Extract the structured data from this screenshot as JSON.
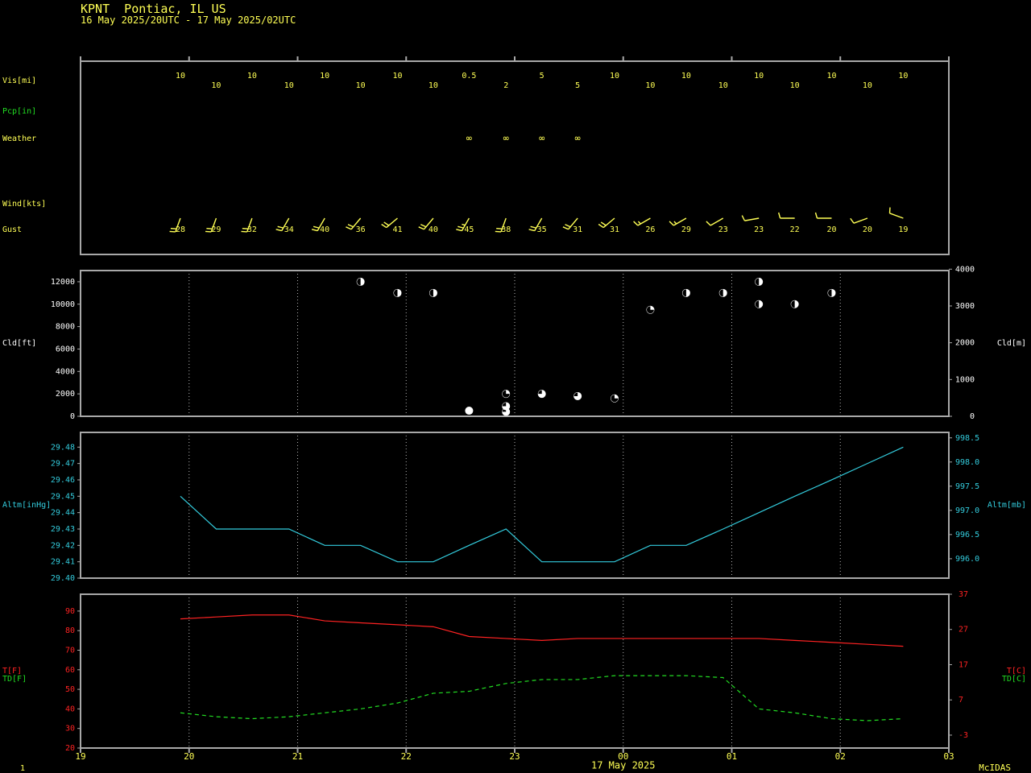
{
  "header": {
    "station": "KPNT  Pontiac, IL US",
    "period": "16 May 2025/20UTC - 17 May 2025/02UTC"
  },
  "footer": {
    "page": "1",
    "center_date": "17 May 2025",
    "credit": "McIDAS"
  },
  "labels": {
    "vis": "Vis[mi]",
    "pcp": "Pcp[in]",
    "weather": "Weather",
    "wind": "Wind[kts]",
    "gust": "Gust",
    "cld_ft": "Cld[ft]",
    "cld_m": "Cld[m]",
    "altm_inhg": "Altm[inHg]",
    "altm_mb": "Altm[mb]",
    "t_f": "T[F]",
    "td_f": "TD[F]",
    "t_c": "T[C]",
    "td_c": "TD[C]"
  },
  "colors": {
    "background": "#000000",
    "frame": "#a8a8a8",
    "grid": "#b4b4b4",
    "yellow": "#ffff55",
    "green": "#22dd22",
    "cyan": "#33ccdd",
    "red": "#ff2222",
    "white": "#ffffff"
  },
  "chart_data": {
    "type": "line",
    "x_axis": {
      "unit": "UTC hour",
      "ticks": [
        "19",
        "20",
        "21",
        "22",
        "23",
        "00",
        "01",
        "02",
        "03"
      ],
      "range": [
        19,
        27
      ]
    },
    "observation_times": [
      19.92,
      20.25,
      20.58,
      20.92,
      21.25,
      21.58,
      21.92,
      22.25,
      22.58,
      22.92,
      23.25,
      23.58,
      23.92,
      24.25,
      24.58,
      24.92,
      25.25,
      25.58,
      25.92,
      26.25,
      26.58
    ],
    "visibility": {
      "unit": "mi",
      "values": [
        "10",
        "10",
        "10",
        "10",
        "10",
        "10",
        "10",
        "10",
        "0.5",
        "2",
        "5",
        "5",
        "10",
        "10",
        "10",
        "10",
        "10",
        "10",
        "10",
        "10",
        "10"
      ]
    },
    "weather": {
      "symbol": "∞",
      "times": [
        22.58,
        22.92,
        23.25,
        23.58
      ]
    },
    "wind": {
      "unit": "kts",
      "directions_deg": [
        200,
        200,
        200,
        210,
        210,
        220,
        230,
        220,
        210,
        200,
        210,
        220,
        230,
        240,
        240,
        240,
        260,
        270,
        270,
        250,
        290
      ],
      "speeds_kts": [
        20,
        20,
        20,
        20,
        20,
        20,
        20,
        20,
        25,
        20,
        20,
        20,
        20,
        15,
        15,
        10,
        10,
        10,
        10,
        10,
        10
      ],
      "gusts": [
        "28",
        "29",
        "32",
        "34",
        "40",
        "36",
        "41",
        "40",
        "45",
        "38",
        "35",
        "31",
        "31",
        "26",
        "29",
        "23",
        "23",
        "22",
        "20",
        "20",
        "19"
      ]
    },
    "cloud": {
      "unit_left": "ft",
      "unit_right": "m",
      "y_ticks_ft": [
        "0",
        "2000",
        "4000",
        "6000",
        "8000",
        "10000",
        "12000"
      ],
      "y_ticks_m": [
        "0",
        "1000",
        "2000",
        "3000",
        "4000"
      ],
      "ylim_ft": [
        0,
        13000
      ],
      "layers": [
        {
          "t": 21.58,
          "ft": 12000,
          "cover": "half"
        },
        {
          "t": 21.92,
          "ft": 11000,
          "cover": "half"
        },
        {
          "t": 22.25,
          "ft": 11000,
          "cover": "half"
        },
        {
          "t": 22.58,
          "ft": 500,
          "cover": "overcast"
        },
        {
          "t": 22.92,
          "ft": 400,
          "cover": "three-quarter"
        },
        {
          "t": 22.92,
          "ft": 900,
          "cover": "three-quarter"
        },
        {
          "t": 22.92,
          "ft": 2000,
          "cover": "quarter"
        },
        {
          "t": 23.25,
          "ft": 2000,
          "cover": "three-quarter"
        },
        {
          "t": 23.58,
          "ft": 1800,
          "cover": "three-quarter"
        },
        {
          "t": 23.92,
          "ft": 1600,
          "cover": "quarter"
        },
        {
          "t": 24.25,
          "ft": 9500,
          "cover": "quarter"
        },
        {
          "t": 24.58,
          "ft": 11000,
          "cover": "half"
        },
        {
          "t": 24.92,
          "ft": 11000,
          "cover": "half"
        },
        {
          "t": 25.25,
          "ft": 12000,
          "cover": "half"
        },
        {
          "t": 25.25,
          "ft": 10000,
          "cover": "half"
        },
        {
          "t": 25.58,
          "ft": 10000,
          "cover": "half"
        },
        {
          "t": 25.92,
          "ft": 11000,
          "cover": "half"
        }
      ]
    },
    "altimeter": {
      "unit_left": "inHg",
      "unit_right": "mb",
      "y_ticks_inhg": [
        "29.40",
        "29.41",
        "29.42",
        "29.43",
        "29.44",
        "29.45",
        "29.46",
        "29.47",
        "29.48"
      ],
      "y_ticks_mb": [
        "996.0",
        "996.5",
        "997.0",
        "997.5",
        "998.0",
        "998.5"
      ],
      "ylim_inhg": [
        29.4,
        29.489
      ],
      "values_inhg": [
        29.45,
        29.43,
        29.43,
        29.43,
        29.42,
        29.42,
        29.41,
        29.41,
        29.42,
        29.43,
        29.41,
        29.41,
        29.41,
        29.42,
        29.42,
        29.43,
        29.44,
        29.45,
        29.46,
        29.47,
        29.48
      ]
    },
    "temperature": {
      "unit_left": "F",
      "unit_right": "C",
      "y_ticks_f": [
        "20",
        "30",
        "40",
        "50",
        "60",
        "70",
        "80",
        "90"
      ],
      "y_ticks_c": [
        "-3",
        "7",
        "17",
        "27",
        "37"
      ],
      "ylim_f": [
        20,
        98.6
      ],
      "series": [
        {
          "name": "T[F]",
          "color": "red",
          "style": "solid",
          "values": [
            86,
            87,
            88,
            88,
            85,
            84,
            83,
            82,
            77,
            76,
            75,
            76,
            76,
            76,
            76,
            76,
            76,
            75,
            74,
            73,
            72
          ]
        },
        {
          "name": "TD[F]",
          "color": "green",
          "style": "dashed",
          "values": [
            38,
            36,
            35,
            36,
            38,
            40,
            43,
            48,
            49,
            53,
            55,
            55,
            57,
            57,
            57,
            56,
            40,
            38,
            35,
            34,
            35
          ]
        }
      ]
    }
  }
}
